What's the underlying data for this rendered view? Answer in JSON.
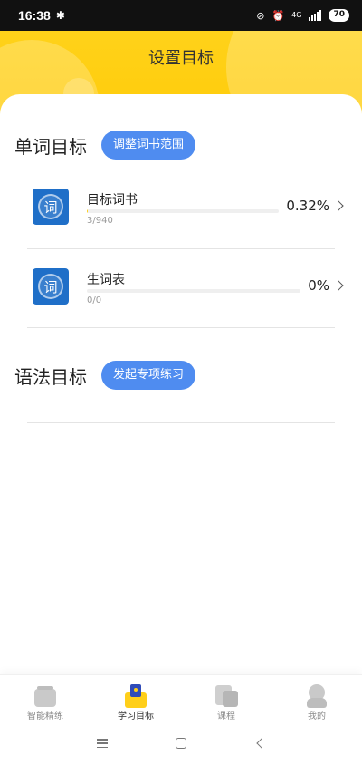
{
  "status_bar": {
    "time": "16:38",
    "network_label": "4G",
    "battery": "70"
  },
  "header": {
    "title": "设置目标"
  },
  "word_section": {
    "title": "单词目标",
    "button_label": "调整词书范围",
    "items": [
      {
        "icon_char": "词",
        "name": "目标词书",
        "count": "3/940",
        "percent": "0.32%",
        "progress": 0.0032
      },
      {
        "icon_char": "词",
        "name": "生词表",
        "count": "0/0",
        "percent": "0%",
        "progress": 0
      }
    ]
  },
  "grammar_section": {
    "title": "语法目标",
    "button_label": "发起专项练习"
  },
  "bottom_nav": {
    "items": [
      {
        "label": "智能精练",
        "icon": "tray-icon"
      },
      {
        "label": "学习目标",
        "icon": "target-icon",
        "active": true
      },
      {
        "label": "课程",
        "icon": "course-icon"
      },
      {
        "label": "我的",
        "icon": "profile-icon"
      }
    ]
  },
  "colors": {
    "header_yellow": "#ffcb08",
    "button_blue": "#4f8cf0",
    "icon_blue": "#1f6fc8",
    "progress_fill": "#ffcf1a"
  }
}
